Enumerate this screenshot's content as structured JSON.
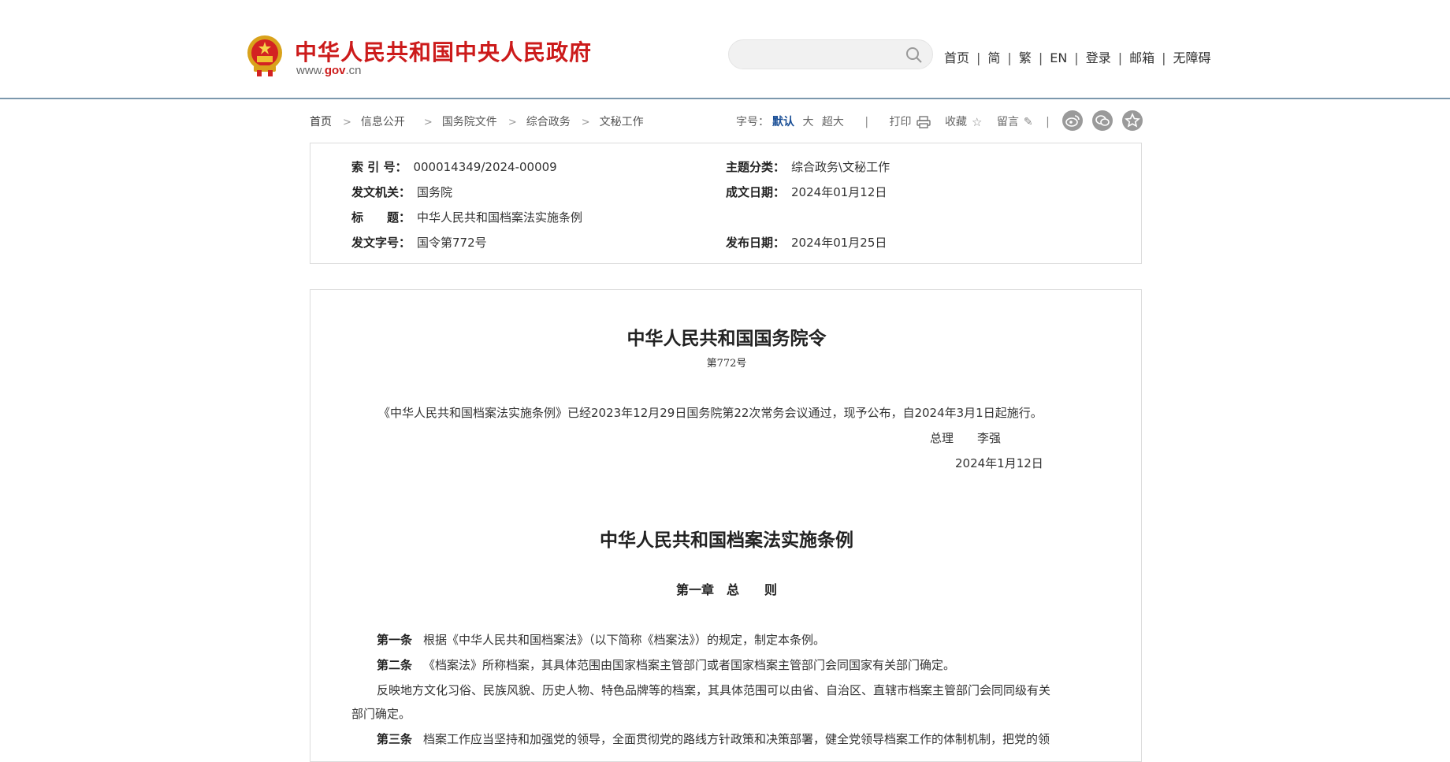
{
  "header": {
    "site_title": "中华人民共和国中央人民政府",
    "site_url_prefix": "www.",
    "site_url_domain": "gov",
    "site_url_suffix": ".cn",
    "search_placeholder": "",
    "nav": [
      "首页",
      "简",
      "繁",
      "EN",
      "登录",
      "邮箱",
      "无障碍"
    ],
    "brand_color": "#cc1b1b"
  },
  "breadcrumb": [
    "首页",
    "信息公开",
    "国务院文件",
    "综合政务",
    "文秘工作"
  ],
  "tools": {
    "font_size_label": "字号：",
    "font_default": "默认",
    "font_large": "大",
    "font_xlarge": "超大",
    "print": "打印",
    "favorite": "收藏",
    "comment": "留言"
  },
  "meta": {
    "index_label": "索 引 号：",
    "index_value": "000014349/2024-00009",
    "topic_label": "主题分类：",
    "topic_value": "综合政务\\文秘工作",
    "issuer_label": "发文机关：",
    "issuer_value": "国务院",
    "written_label": "成文日期：",
    "written_value": "2024年01月12日",
    "title_label": "标　　题：",
    "title_value": "中华人民共和国档案法实施条例",
    "docno_label": "发文字号：",
    "docno_value": "国令第772号",
    "published_label": "发布日期：",
    "published_value": "2024年01月25日"
  },
  "article": {
    "order_title": "中华人民共和国国务院令",
    "order_no": "第772号",
    "intro": "《中华人民共和国档案法实施条例》已经2023年12月29日国务院第22次常务会议通过，现予公布，自2024年3月1日起施行。",
    "premier_title": "总理",
    "premier_name": "李强",
    "sign_date": "2024年1月12日",
    "regulation_title": "中华人民共和国档案法实施条例",
    "chapter": "第一章　总　　则",
    "art1_label": "第一条",
    "art1_text": "根据《中华人民共和国档案法》（以下简称《档案法》）的规定，制定本条例。",
    "art2_label": "第二条",
    "art2_text": "《档案法》所称档案，其具体范围由国家档案主管部门或者国家档案主管部门会同国家有关部门确定。",
    "para3_line1": "反映地方文化习俗、民族风貌、历史人物、特色品牌等的档案，其具体范围可以由省、自治区、直辖市档案主管部门会同同级有关",
    "para3_line2": "部门确定。",
    "art3_label": "第三条",
    "art3_text": "档案工作应当坚持和加强党的领导，全面贯彻党的路线方针政策和决策部署，健全党领导档案工作的体制机制，把党的领"
  }
}
